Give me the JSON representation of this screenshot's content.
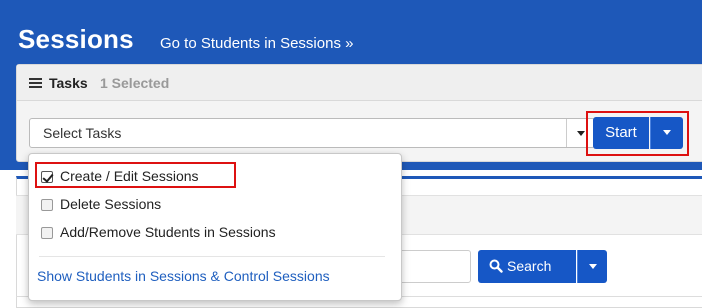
{
  "header": {
    "title": "Sessions",
    "link_label": "Go to Students in Sessions »"
  },
  "tasks": {
    "label": "Tasks",
    "selected_count": "1 Selected",
    "select_placeholder": "Select Tasks",
    "start_label": "Start"
  },
  "dropdown": {
    "items": [
      {
        "label": "Create / Edit Sessions",
        "checked": true
      },
      {
        "label": "Delete Sessions",
        "checked": false
      },
      {
        "label": "Add/Remove Students in Sessions",
        "checked": false
      }
    ],
    "link_label": "Show Students in Sessions & Control Sessions"
  },
  "search": {
    "button_label": "Search"
  },
  "colors": {
    "header_blue": "#1e58b8",
    "button_blue": "#1657c6",
    "highlight_red": "#dd1111",
    "link_blue": "#1f5fbf"
  }
}
